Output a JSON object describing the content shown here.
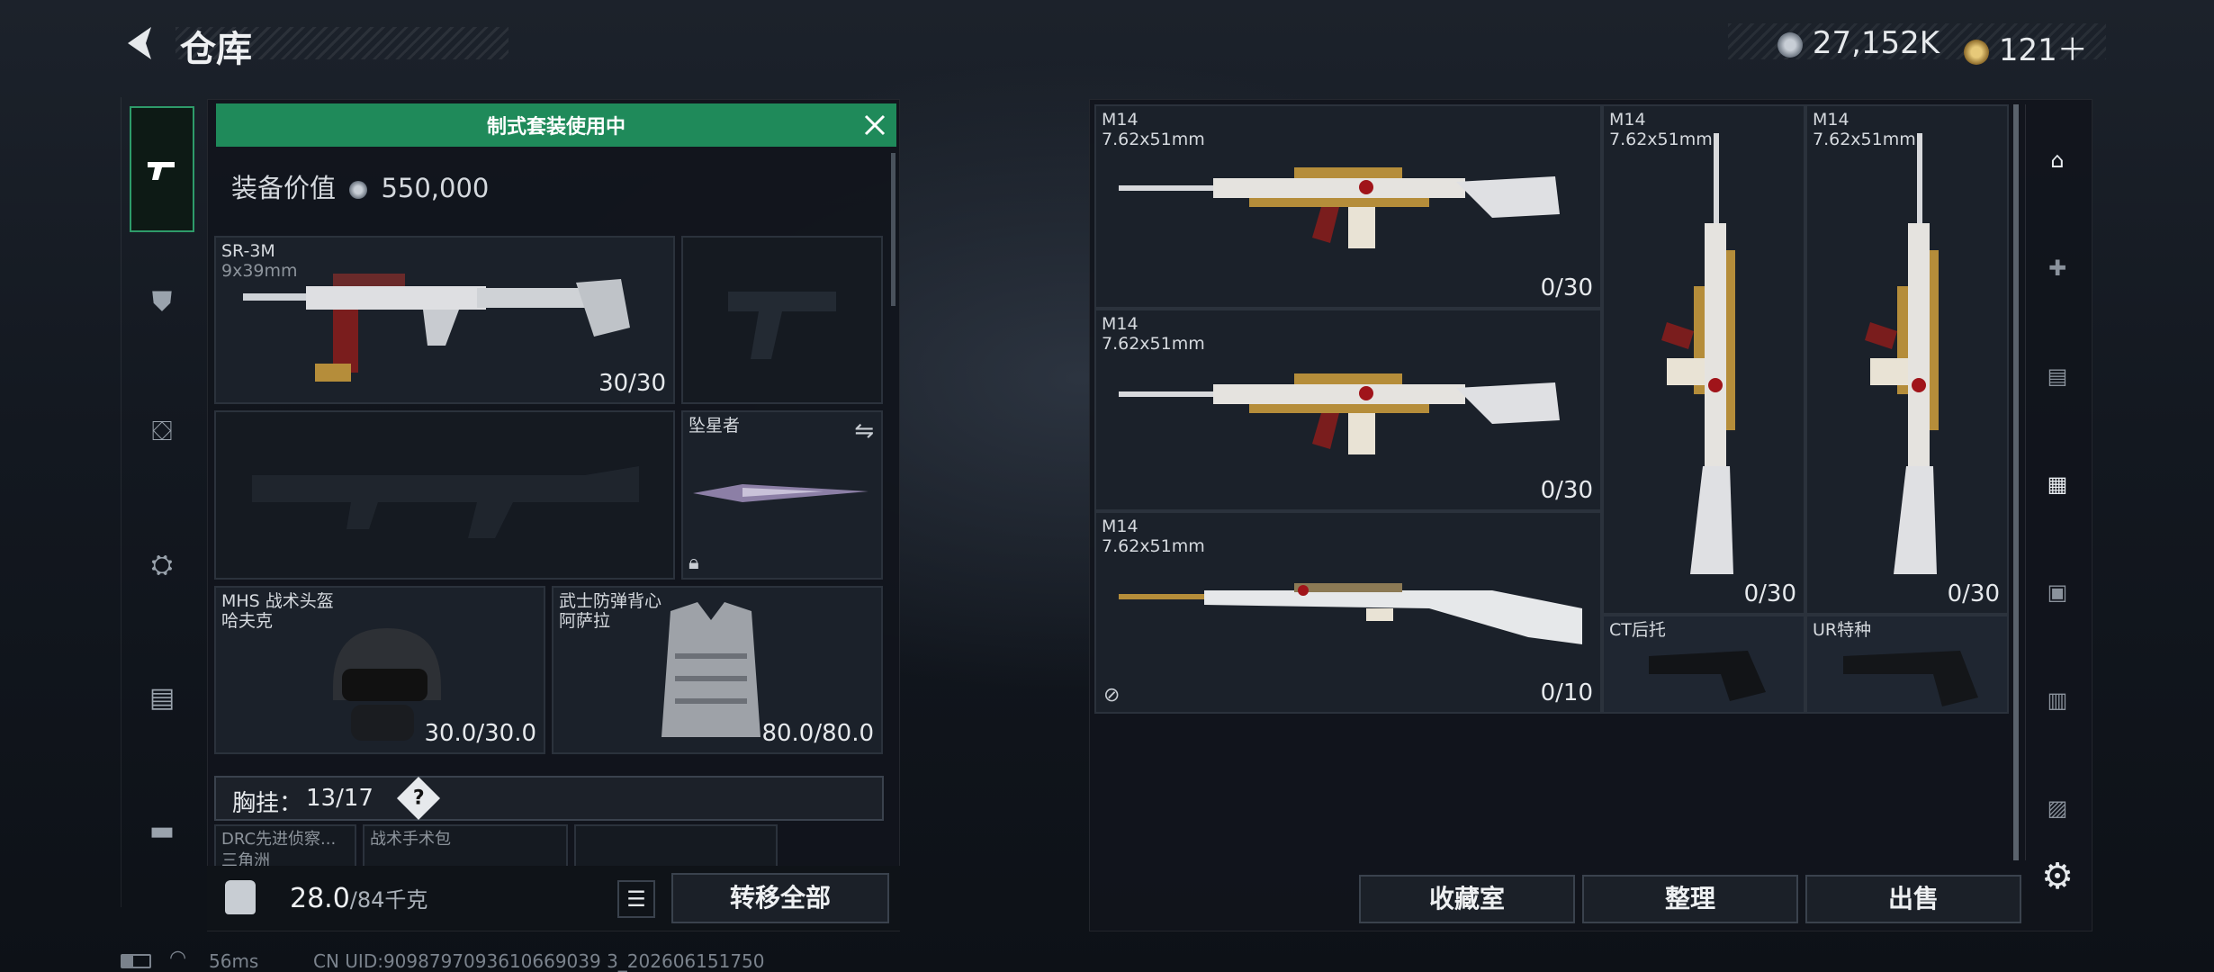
{
  "header": {
    "title": "仓库",
    "currency1": "27,152K",
    "currency2": "121＋"
  },
  "notice": {
    "label": "制式套装使用中"
  },
  "equip_value": {
    "label": "装备价值",
    "value": "550,000"
  },
  "left_slots": {
    "primary": {
      "name": "SR-3M",
      "caliber": "9x39mm",
      "count": "30/30"
    },
    "melee": {
      "name": "坠星者"
    },
    "helmet": {
      "type": "MHS 战术头盔",
      "name": "哈夫克",
      "durability": "30.0/30.0"
    },
    "armor": {
      "type": "武士防弹背心",
      "name": "阿萨拉",
      "durability": "80.0/80.0"
    },
    "rig": {
      "label": "胸挂：",
      "count": "13/17",
      "help": "?"
    },
    "items": [
      "DRC先进侦察...",
      "战术手术包"
    ],
    "items_sub": [
      "三角洲",
      ""
    ]
  },
  "weight": {
    "current": "28.0",
    "max": "/84千克"
  },
  "buttons": {
    "transfer_all": "转移全部",
    "collection": "收藏室",
    "organize": "整理",
    "sell": "出售"
  },
  "storage": [
    {
      "name": "M14",
      "caliber": "7.62x51mm",
      "count": "0/30"
    },
    {
      "name": "M14",
      "caliber": "7.62x51mm",
      "count": "0/30"
    },
    {
      "name": "M14",
      "caliber": "7.62x51mm",
      "count": "0/10"
    },
    {
      "name": "M14",
      "caliber": "7.62x51mm",
      "count": "0/30"
    },
    {
      "name": "M14",
      "caliber": "7.62x51mm",
      "count": "0/30"
    },
    {
      "name": "CT后托"
    },
    {
      "name": "UR特种"
    }
  ],
  "status": {
    "ping": "56ms",
    "uid": "CN UID:9098797093610669039 3_202606151750"
  },
  "icons": {
    "back": "back-arrow-icon",
    "gear": "gear-icon",
    "pistol": "pistol-icon"
  },
  "colors": {
    "accent": "#1f8a5a",
    "panel": "#11151c",
    "slot_border": "#2b323c"
  }
}
